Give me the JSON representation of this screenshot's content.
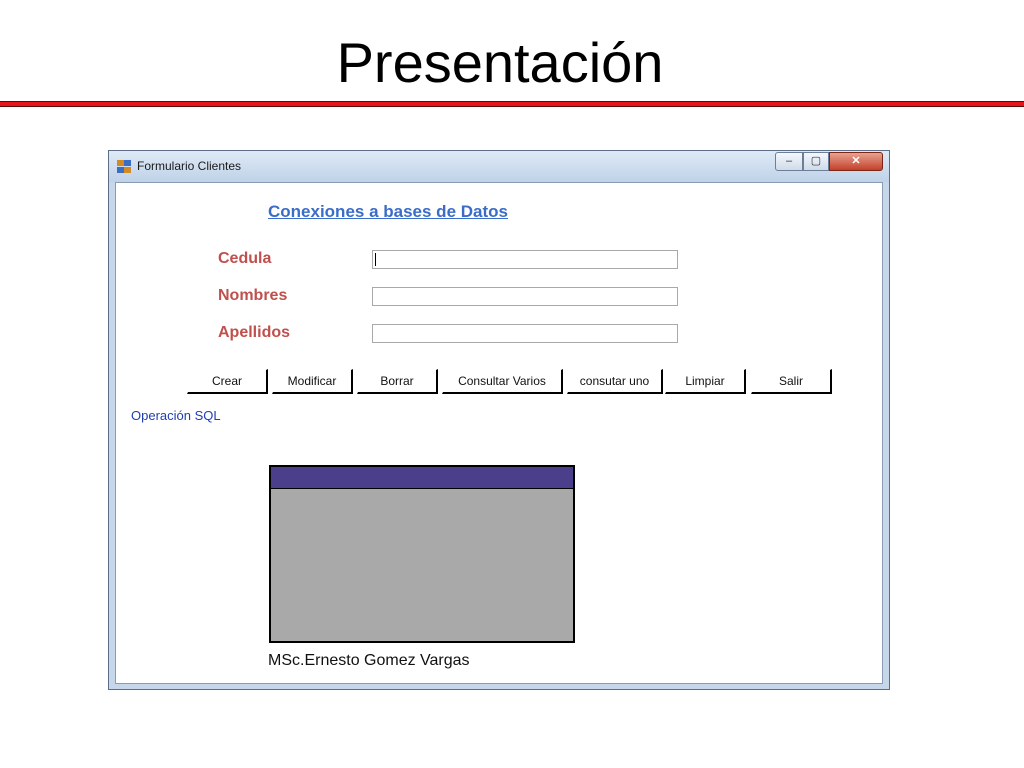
{
  "slide": {
    "title": "Presentación"
  },
  "window": {
    "title": "Formulario Clientes",
    "controls": {
      "minimize": "–",
      "maximize": "▢",
      "close": "✕"
    }
  },
  "form": {
    "header": "Conexiones a bases de Datos",
    "fields": [
      {
        "label": "Cedula",
        "value": ""
      },
      {
        "label": "Nombres",
        "value": ""
      },
      {
        "label": "Apellidos",
        "value": ""
      }
    ],
    "buttons": [
      {
        "label": "Crear"
      },
      {
        "label": "Modificar"
      },
      {
        "label": "Borrar"
      },
      {
        "label": "Consultar Varios"
      },
      {
        "label": "consutar uno"
      },
      {
        "label": "Limpiar"
      },
      {
        "label": "Salir"
      }
    ],
    "sql_label": "Operación SQL",
    "author": "MSc.Ernesto Gomez Vargas"
  },
  "colors": {
    "title_rule": "#e8141c",
    "header_text": "#3a6dc9",
    "field_label": "#c0504d",
    "sql_label": "#1f3fb0",
    "grid_header": "#4b3f8c",
    "grid_body": "#a9a9a9"
  },
  "icons": {
    "app": "form-app-icon",
    "minimize": "minimize-icon",
    "maximize": "maximize-icon",
    "close": "close-icon"
  }
}
